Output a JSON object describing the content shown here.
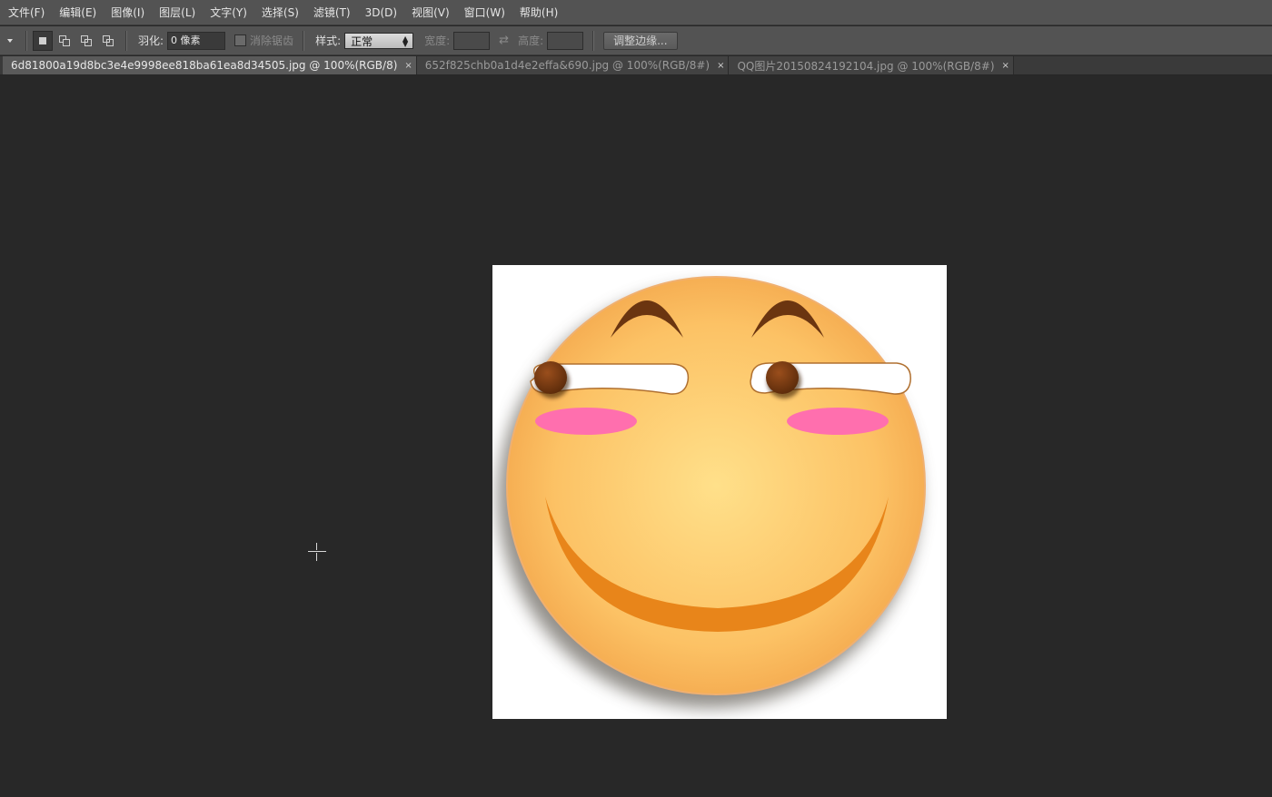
{
  "menu": [
    "文件(F)",
    "编辑(E)",
    "图像(I)",
    "图层(L)",
    "文字(Y)",
    "选择(S)",
    "滤镜(T)",
    "3D(D)",
    "视图(V)",
    "窗口(W)",
    "帮助(H)"
  ],
  "options": {
    "feather_label": "羽化:",
    "feather_value": "0 像素",
    "antialias_label": "消除锯齿",
    "style_label": "样式:",
    "style_value": "正常",
    "width_label": "宽度:",
    "height_label": "高度:",
    "refine_edge_button": "调整边缘..."
  },
  "tabs": [
    {
      "label": "6d81800a19d8bc3e4e9998ee818ba61ea8d34505.jpg @ 100%(RGB/8)",
      "active": true
    },
    {
      "label": "652f825chb0a1d4e2effa&690.jpg @ 100%(RGB/8#)",
      "active": false
    },
    {
      "label": "QQ图片20150824192104.jpg @ 100%(RGB/8#)",
      "active": false
    }
  ],
  "tab_close_glyph": "×",
  "colors": {
    "face_center": "#ffe08a",
    "face_edge": "#f6ad55",
    "smile": "#e8851a",
    "eyebrow": "#6b3510",
    "pupil": "#7a3a12",
    "blush": "#ff6fae"
  }
}
